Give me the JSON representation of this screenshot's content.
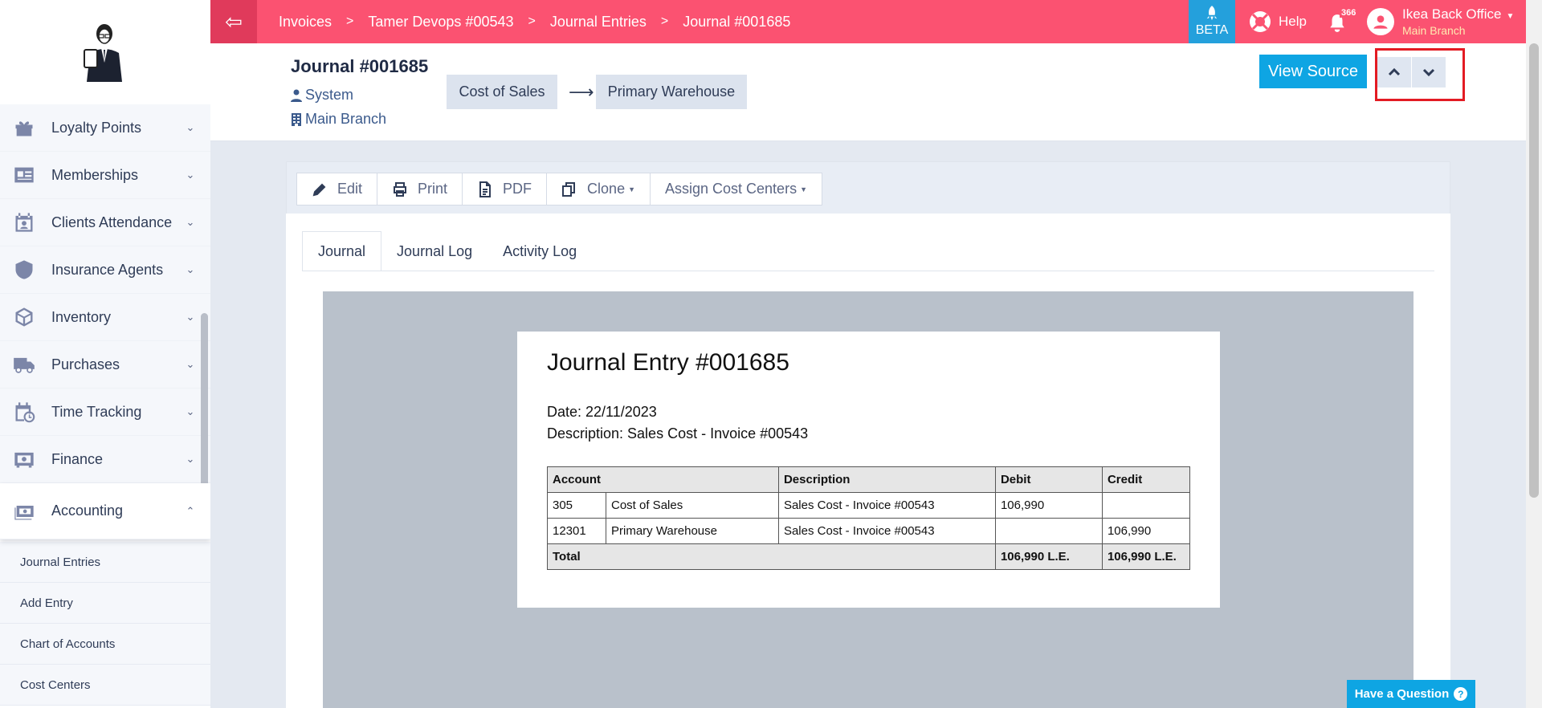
{
  "sidebar": {
    "items": [
      {
        "label": "Loyalty Points",
        "icon": "gift-icon"
      },
      {
        "label": "Memberships",
        "icon": "id-card-icon"
      },
      {
        "label": "Clients Attendance",
        "icon": "calendar-user-icon"
      },
      {
        "label": "Insurance Agents",
        "icon": "shield-icon"
      },
      {
        "label": "Inventory",
        "icon": "box-icon"
      },
      {
        "label": "Purchases",
        "icon": "truck-icon"
      },
      {
        "label": "Time Tracking",
        "icon": "calendar-clock-icon"
      },
      {
        "label": "Finance",
        "icon": "safe-icon"
      },
      {
        "label": "Accounting",
        "icon": "money-icon"
      }
    ],
    "sub_items": [
      "Journal Entries",
      "Add Entry",
      "Chart of Accounts",
      "Cost Centers"
    ]
  },
  "topbar": {
    "breadcrumb": [
      "Invoices",
      "Tamer Devops #00543",
      "Journal Entries",
      "Journal #001685"
    ],
    "beta": "BETA",
    "help": "Help",
    "notifications": "366",
    "user_name": "Ikea Back Office",
    "user_branch": "Main Branch",
    "color": "#fb5271"
  },
  "header": {
    "title": "Journal #001685",
    "created_by": "System",
    "branch": "Main Branch",
    "from_account": "Cost of Sales",
    "to_account": "Primary Warehouse",
    "view_source": "View Source"
  },
  "toolbar": {
    "edit": "Edit",
    "print": "Print",
    "pdf": "PDF",
    "clone": "Clone",
    "assign": "Assign Cost Centers"
  },
  "tabs": [
    "Journal",
    "Journal Log",
    "Activity Log"
  ],
  "document": {
    "title": "Journal Entry #001685",
    "date": "Date: 22/11/2023",
    "description": "Description: Sales Cost - Invoice #00543",
    "headers": {
      "account": "Account",
      "description": "Description",
      "debit": "Debit",
      "credit": "Credit"
    },
    "rows": [
      {
        "code": "305",
        "name": "Cost of Sales",
        "description": "Sales Cost - Invoice #00543",
        "debit": "106,990",
        "credit": ""
      },
      {
        "code": "12301",
        "name": "Primary Warehouse",
        "description": "Sales Cost - Invoice #00543",
        "debit": "",
        "credit": "106,990"
      }
    ],
    "total_label": "Total",
    "total_debit": "106,990 L.E.",
    "total_credit": "106,990 L.E."
  },
  "footer": {
    "question": "Have a Question"
  }
}
